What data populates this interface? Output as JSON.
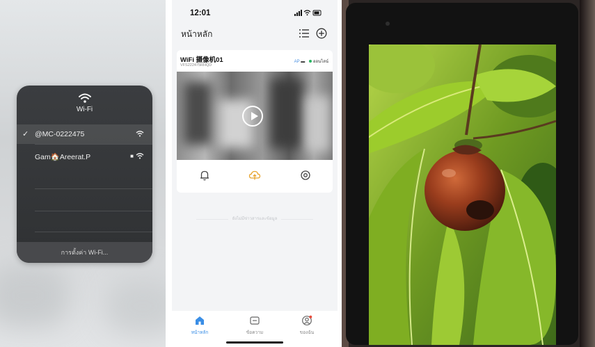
{
  "wifi_menu": {
    "title": "Wi-Fi",
    "networks": [
      {
        "name": "@MC-0222475",
        "connected": true,
        "locked": false,
        "icon": "wifi-signal-icon"
      },
      {
        "name": "Gam🏠Areerat.P",
        "connected": false,
        "locked": true,
        "icon": "wifi-signal-icon"
      }
    ],
    "check_mark": "✓",
    "lock_glyph": "🔒",
    "settings_label": "การตั้งค่า Wi-Fi..."
  },
  "camera_app": {
    "status_bar": {
      "time": "12:01",
      "icons": "▮▮▮ ≈ ▬"
    },
    "header": {
      "title": "หน้าหลัก",
      "list_icon": "list-icon",
      "add_icon": "add-circle-icon"
    },
    "camera": {
      "name": "WiFi 摄像机01",
      "device_id": "VFS222475RHQD",
      "mode": "AP",
      "status": "ออนไลน์",
      "status_color": "#28b463"
    },
    "actions": [
      "bell-icon",
      "cloud-upload-icon",
      "settings-icon"
    ],
    "empty_message": "ยังไม่มีข่าวสารและข้อมูล",
    "tabs": [
      {
        "label": "หน้าหลัก",
        "icon": "home-icon",
        "active": true
      },
      {
        "label": "ข้อความ",
        "icon": "message-icon",
        "active": false
      },
      {
        "label": "ของฉัน",
        "icon": "profile-icon",
        "active": false
      }
    ],
    "accent_color": "#3a8ee6"
  },
  "tablet_photo": {
    "subject": "mangosteen fruit on tree",
    "colors": {
      "leaf": "#8fbf2a",
      "fruit": "#8a3a1a",
      "bezel": "#121212"
    }
  }
}
